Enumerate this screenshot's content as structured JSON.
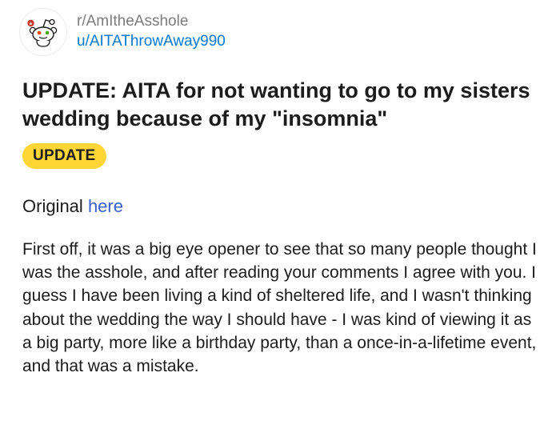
{
  "post": {
    "subreddit": "r/AmItheAsshole",
    "author": "u/AITAThrowAway990",
    "title": "UPDATE: AITA for not wanting to go to my sisters wedding because of my \"insomnia\"",
    "flair": "UPDATE",
    "flair_color": "#ffd635",
    "original_label": "Original",
    "original_link_text": "here",
    "link_color": "#3a5fc9",
    "body": "First off, it was a big eye opener to see that so many people thought I was the asshole, and after reading your comments I agree with you. I guess I have been living a kind of sheltered life, and I wasn't thinking about the wedding the way I should have - I was kind of viewing it as a big party, more like a birthday party, than a once-in-a-lifetime event, and that was a mistake."
  },
  "icons": {
    "avatar": "reddit-snoo-icon"
  }
}
